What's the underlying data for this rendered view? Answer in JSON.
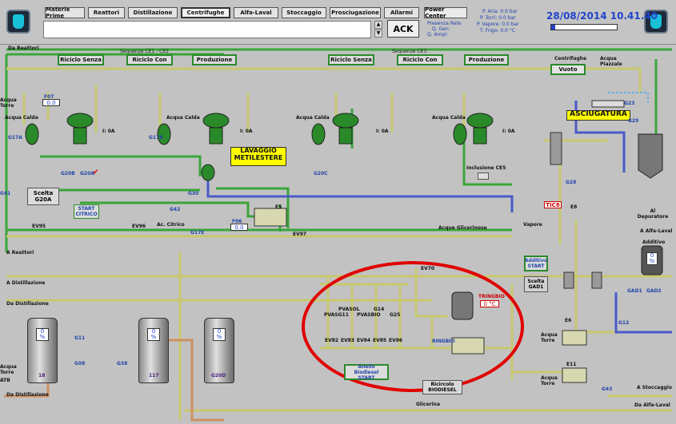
{
  "topbar": {
    "nav": [
      "Materie Prime",
      "Reattori",
      "Distillazione",
      "Centrifughe",
      "Alfa-Laval",
      "Stoccaggio",
      "Prosciugazione",
      "Allarmi"
    ],
    "power_center": "Power Center",
    "ack": "ACK",
    "presenza_rete": "Presenza Rete",
    "q_gen": "Q. Gen:",
    "q_ampl": "Q. Ampl:",
    "p_aria": "P. Aria: 0.0 bar",
    "p_torri": "P. Torri: 0.0 bar",
    "p_vapore": "P. Vapore: 0.0 bar",
    "t_frigo": "T. Frigo: 0.0 °C",
    "datetime": "28/08/2014 10.41.40"
  },
  "sequences": {
    "ce1_title": "Sequenze CE1 - CE2",
    "ce3_title": "Sequenze CE3",
    "ricircolo_senza": "Riciclo Senza",
    "ricircolo_con": "Riciclo Con",
    "produzione": "Produzione"
  },
  "labels": {
    "da_reattori": "Da Reattori",
    "a_reattori": "A Reattori",
    "a_distillazione": "A Distillazione",
    "da_distillazione": "Da Distillazione",
    "da_distillazione2": "Da Distillazione",
    "lavaggio": "LAVAGGIO METILESTERE",
    "asciugatura": "ASCIUGATURA",
    "centrifughe": "Centrifughe",
    "vuoto": "Vuoto",
    "acqua_piazzale": "Acqua Piazzale",
    "acqua_torre": "Acqua Torre",
    "acqua_glicerinose": "Acque Glicerinose",
    "a_alfa_laval": "A Alfa-Laval",
    "additivo": "Additivo",
    "additivo_start": "Additivo START",
    "scelta_gad1": "Scelta GAD1",
    "scelta_g20a": "Scelta G20A",
    "start_citrico": "START CITRICO",
    "inclusione_ce5": "Inclusione CE5",
    "anello_biodiesel": "Anello Biodiesel START",
    "ricircolo_biodiesel": "Ricircolo BIODIESEL",
    "glicerina": "Glicerina",
    "a_stoccaggio": "A Stoccaggio",
    "da_alfa_laval": "Da Alfa-Laval",
    "al_depuratore": "Al Depuratore",
    "vapore": "Vapore",
    "acido_citrico": "Ac. Citrico",
    "acqua_calda": "Acqua Calda",
    "i_oa": "I: 0A",
    "pvasol": "PVASOL",
    "pvasg11": "PVASG11",
    "pvasbio": "PVASBIO",
    "g14": "G14",
    "g25": "G25",
    "ringhio": "RINGBIO",
    "t_ringbio": "TRINGBIO",
    "ringbio_temp": "0 °C",
    "tic8": "TIC8",
    "e8": "E8",
    "e5": "E5",
    "e6": "E6",
    "e11": "E11",
    "ev97": "EV97",
    "ev95": "EV95",
    "ev96": "EV96",
    "ev70": "EV70",
    "g30": "G30",
    "g42": "G42",
    "g17e": "G17E",
    "g17a": "G17A",
    "g17b": "G17B",
    "g20b": "G20B",
    "g20a": "G20A",
    "g20c": "G20C",
    "g28": "G28",
    "g23": "G23",
    "g29": "G29",
    "g41": "G41",
    "gad1": "GAD1",
    "gad2": "GAD2",
    "g12": "G12",
    "g43": "G43",
    "g11": "G11",
    "g08": "G08",
    "g38": "G38",
    "atb": "ATB",
    "g20d": "G20D",
    "t117": "117",
    "t18": "18",
    "tank_zero": "0",
    "tank_pct": "%",
    "f07": "F07",
    "f06": "F06",
    "f07val": "0.0",
    "f06val": "0.0",
    "ev_list": [
      "EV82",
      "EV83",
      "EV84",
      "EV85",
      "EV86"
    ]
  }
}
